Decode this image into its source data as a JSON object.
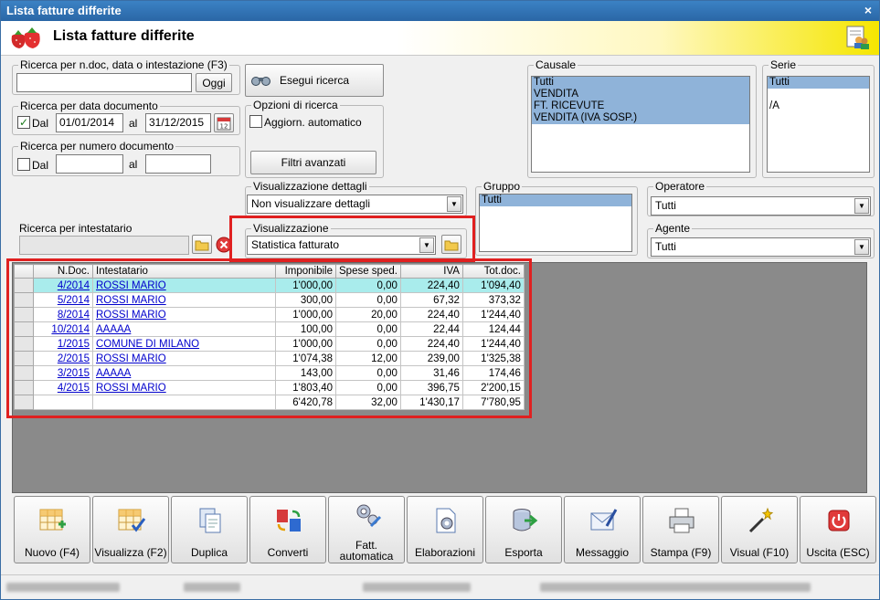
{
  "window": {
    "title": "Lista fatture differite",
    "close_glyph": "×"
  },
  "header": {
    "title": "Lista fatture differite",
    "logo_icon": "strawberry-logo-icon",
    "right_icon": "users-report-icon"
  },
  "search_text": {
    "label": "Ricerca per n.doc, data o intestazione (F3)",
    "value": "",
    "button": "Oggi"
  },
  "search_date": {
    "label": "Ricerca per data documento",
    "checked": true,
    "from_label": "Dal",
    "from": "01/01/2014",
    "to_label": "al",
    "to": "31/12/2015"
  },
  "search_number": {
    "label": "Ricerca per numero documento",
    "checked": false,
    "from_label": "Dal",
    "from": "",
    "to_label": "al",
    "to": ""
  },
  "search_holder": {
    "label": "Ricerca per intestatario",
    "value": ""
  },
  "run_search": {
    "label": "Esegui ricerca"
  },
  "search_options": {
    "label": "Opzioni di ricerca",
    "auto_update_label": "Aggiorn. automatico",
    "auto_update": false,
    "advanced_filters": "Filtri avanzati"
  },
  "causale": {
    "label": "Causale",
    "items": [
      "Tutti",
      "VENDITA",
      "FT. RICEVUTE",
      "VENDITA (IVA SOSP.)"
    ]
  },
  "serie": {
    "label": "Serie",
    "items": [
      "Tutti",
      "",
      "/A"
    ]
  },
  "details_view": {
    "label": "Visualizzazione dettagli",
    "value": "Non visualizzare dettagli"
  },
  "gruppo": {
    "label": "Gruppo",
    "items": [
      "Tutti"
    ]
  },
  "operatore": {
    "label": "Operatore",
    "value": "Tutti"
  },
  "agente": {
    "label": "Agente",
    "value": "Tutti"
  },
  "visualizzazione": {
    "label": "Visualizzazione",
    "value": "Statistica fatturato"
  },
  "grid": {
    "columns": [
      "N.Doc.",
      "Intestatario",
      "Imponibile",
      "Spese sped.",
      "IVA",
      "Tot.doc."
    ],
    "rows": [
      {
        "ndoc": "4/2014",
        "holder": "ROSSI MARIO",
        "imponibile": "1'000,00",
        "spese": "0,00",
        "iva": "224,40",
        "tot": "1'094,40"
      },
      {
        "ndoc": "5/2014",
        "holder": "ROSSI MARIO",
        "imponibile": "300,00",
        "spese": "0,00",
        "iva": "67,32",
        "tot": "373,32"
      },
      {
        "ndoc": "8/2014",
        "holder": "ROSSI MARIO",
        "imponibile": "1'000,00",
        "spese": "20,00",
        "iva": "224,40",
        "tot": "1'244,40"
      },
      {
        "ndoc": "10/2014",
        "holder": "AAAAA",
        "imponibile": "100,00",
        "spese": "0,00",
        "iva": "22,44",
        "tot": "124,44"
      },
      {
        "ndoc": "1/2015",
        "holder": "COMUNE DI MILANO",
        "imponibile": "1'000,00",
        "spese": "0,00",
        "iva": "224,40",
        "tot": "1'244,40"
      },
      {
        "ndoc": "2/2015",
        "holder": "ROSSI MARIO",
        "imponibile": "1'074,38",
        "spese": "12,00",
        "iva": "239,00",
        "tot": "1'325,38"
      },
      {
        "ndoc": "3/2015",
        "holder": "AAAAA",
        "imponibile": "143,00",
        "spese": "0,00",
        "iva": "31,46",
        "tot": "174,46"
      },
      {
        "ndoc": "4/2015",
        "holder": "ROSSI MARIO",
        "imponibile": "1'803,40",
        "spese": "0,00",
        "iva": "396,75",
        "tot": "2'200,15"
      }
    ],
    "totals": {
      "imponibile": "6'420,78",
      "spese": "32,00",
      "iva": "1'430,17",
      "tot": "7'780,95"
    }
  },
  "toolbar": {
    "buttons": [
      {
        "label": "Nuovo (F4)",
        "icon": "new-grid-icon"
      },
      {
        "label": "Visualizza (F2)",
        "icon": "view-grid-icon"
      },
      {
        "label": "Duplica",
        "icon": "duplicate-icon"
      },
      {
        "label": "Converti",
        "icon": "convert-icon"
      },
      {
        "label": "Fatt. automatica",
        "icon": "auto-invoice-icon"
      },
      {
        "label": "Elaborazioni",
        "icon": "processing-icon"
      },
      {
        "label": "Esporta",
        "icon": "export-icon"
      },
      {
        "label": "Messaggio",
        "icon": "message-icon"
      },
      {
        "label": "Stampa (F9)",
        "icon": "printer-icon"
      },
      {
        "label": "Visual (F10)",
        "icon": "magic-wand-icon"
      },
      {
        "label": "Uscita (ESC)",
        "icon": "power-icon"
      }
    ]
  },
  "colors": {
    "title_bar": "#2a66a6",
    "highlight_box": "#e02020",
    "selected_row": "#a9ecec",
    "list_selection": "#8fb3d9"
  }
}
